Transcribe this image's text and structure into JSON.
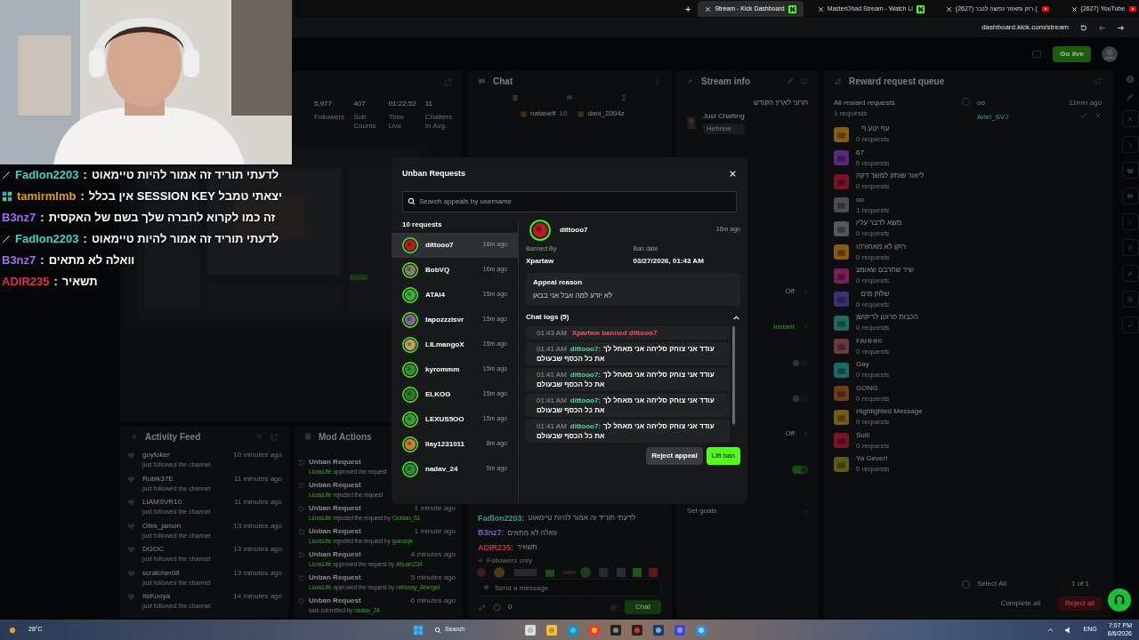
{
  "browser": {
    "new_tab": "+",
    "tabs": [
      {
        "title": "Stream - Kick Dashboard",
        "selected": true,
        "kind": "kick"
      },
      {
        "title": "MasterOhad Stream - Watch Li",
        "selected": false,
        "kind": "kick"
      },
      {
        "title": "(2627) רוק ומאוזר נפשה לנבר (",
        "selected": false,
        "kind": "youtube"
      },
      {
        "title": "(2627) YouTube",
        "selected": false,
        "kind": "youtube"
      }
    ],
    "url": "dashboard.kick.com/stream"
  },
  "header": {
    "go_live": "Go live"
  },
  "stats": [
    {
      "value": "5,977",
      "label": "Followers"
    },
    {
      "value": "407",
      "label": "Sub Counts"
    },
    {
      "value": "01:22:52",
      "label": "Time Live"
    },
    {
      "value": "11",
      "label": "Chatters In Avg."
    }
  ],
  "chat_panel": {
    "title": "Chat",
    "chatters": [
      {
        "name": "natanelf",
        "count": "10"
      },
      {
        "name": "dani_2004z"
      }
    ],
    "messages": [
      {
        "name": "Fadlon2203:",
        "text": "לדעתי תוריד זה אמור להיות טיימאוט",
        "color": "#2f9e85"
      },
      {
        "name": "B3nz7:",
        "text": "וואלה לא מתאים",
        "color": "#8060c0"
      },
      {
        "name": "ADIR235:",
        "text": "תשאיר",
        "color": "#c03050"
      }
    ],
    "mode": "Followers only",
    "placeholder": "Send a message",
    "send": "Chat",
    "count": "0"
  },
  "stream_info": {
    "title": "Stream info",
    "stream_title": "חרוני לארץ הקודש",
    "category": "Just Chatting",
    "language": "Hebrew",
    "settings": [
      {
        "kind": "value",
        "value": "Off"
      },
      {
        "kind": "value",
        "value": "Instant"
      },
      {
        "kind": "toggle",
        "on": false
      },
      {
        "kind": "toggle",
        "on": false
      },
      {
        "kind": "value",
        "value": "Off"
      },
      {
        "kind": "toggle",
        "on": true
      }
    ],
    "goals": "Set goals"
  },
  "reward_queue": {
    "title": "Reward request queue",
    "all": "All reward requests",
    "all_count": "1 requests",
    "pending": {
      "reward": "oo",
      "user": "Ariel_SVJ",
      "time": "11min ago",
      "checked": false
    },
    "rewards": [
      {
        "name": "עף יטע ף",
        "count": "0 requests",
        "color": "#8a5a12"
      },
      {
        "name": "67",
        "count": "0 requests",
        "color": "#5a2a7a"
      },
      {
        "name": "ליאור שותק למשך דקה",
        "count": "0 requests",
        "color": "#7a1424"
      },
      {
        "name": "oo",
        "count": "1 requests",
        "color": "#4a4e52"
      },
      {
        "name": "משא לדבר עליו",
        "count": "0 requests",
        "color": "#55595d"
      },
      {
        "name": "רוקן לא מאחורה!",
        "count": "0 requests",
        "color": "#8a5a12"
      },
      {
        "name": "שיר שחרבם שאומצ",
        "count": "0 requests",
        "color": "#7a1e55"
      },
      {
        "name": "שלוק מים",
        "count": "0 requests",
        "color": "#3a3270"
      },
      {
        "name": "הכבות פרוטן לריקושן",
        "count": "0 requests",
        "color": "#1e6a5e"
      },
      {
        "name": "FAHHH!",
        "count": "0 requests",
        "color": "#6a3a44"
      },
      {
        "name": "Gay",
        "count": "0 requests",
        "color": "#1a6a6a"
      },
      {
        "name": "GONG",
        "count": "0 requests",
        "color": "#6a3e1a"
      },
      {
        "name": "Highlighted Message",
        "count": "0 requests",
        "color": "#7a5a12"
      },
      {
        "name": "Sulil",
        "count": "0 requests",
        "color": "#7a1424"
      },
      {
        "name": "Ya Gever!",
        "count": "0 requests",
        "color": "#5a5a12"
      }
    ],
    "select_all": {
      "label": "Select All",
      "checked": false
    },
    "pages": "1 of 1",
    "complete_all": "Complete all",
    "reject_all": "Reject all"
  },
  "activity_feed": {
    "title": "Activity Feed",
    "items": [
      {
        "name": "guytoker",
        "text": "just followed the channel",
        "time": "10 minutes ago"
      },
      {
        "name": "Rubik37E",
        "text": "just followed the channel",
        "time": "11 minutes ago"
      },
      {
        "name": "LIAMSVR10",
        "text": "just followed the channel",
        "time": "11 minutes ago"
      },
      {
        "name": "Ofek_jamon",
        "text": "just followed the channel",
        "time": "13 minutes ago"
      },
      {
        "name": "DGOC",
        "text": "just followed the channel",
        "time": "13 minutes ago"
      },
      {
        "name": "scratcher08",
        "text": "just followed the channel",
        "time": "13 minutes ago"
      },
      {
        "name": "ItsKooya",
        "text": "just followed the channel",
        "time": "14 minutes ago"
      }
    ]
  },
  "mod_actions": {
    "title": "Mod Actions",
    "items": [
      {
        "title": "Unban Request",
        "moderator": "LionsLife",
        "text": "approved the request"
      },
      {
        "title": "Unban Request",
        "moderator": "LionsLife",
        "text": "rejected the request"
      },
      {
        "title": "Unban Request",
        "moderator": "LionsLife",
        "text": "rejected the request by",
        "user": "Goldan_61",
        "time": "1 minute ago"
      },
      {
        "title": "Unban Request",
        "moderator": "LionsLife",
        "text": "rejected the request by",
        "user": "guessyk",
        "time": "1 minute ago"
      },
      {
        "title": "Unban Request",
        "moderator": "LionsLife",
        "text": "approved the request by",
        "user": "Abuan234",
        "time": "4 minutes ago"
      },
      {
        "title": "Unban Request",
        "moderator": "LionsLife",
        "text": "approved the request by",
        "user": "nehoray_Abergel",
        "time": "5 minutes ago"
      },
      {
        "title": "Unban Request",
        "text": "was submitted by",
        "user": "nadav_24",
        "time": "6 minutes ago"
      }
    ]
  },
  "modal": {
    "title": "Unban Requests",
    "search_placeholder": "Search appeals by username",
    "count": "10 requests",
    "requests": [
      {
        "name": "dittooo7",
        "time": "16m ago",
        "selected": true
      },
      {
        "name": "BobVQ",
        "time": "16m ago",
        "selected": false
      },
      {
        "name": "ATAI4",
        "time": "15m ago",
        "selected": false
      },
      {
        "name": "tapozzzisvr",
        "time": "15m ago",
        "selected": false
      },
      {
        "name": "LILmangoX",
        "time": "15m ago",
        "selected": false
      },
      {
        "name": "kyrommm",
        "time": "15m ago",
        "selected": false
      },
      {
        "name": "ELKOG",
        "time": "15m ago",
        "selected": false
      },
      {
        "name": "LEXUS5OO",
        "time": "15m ago",
        "selected": false
      },
      {
        "name": "Ilay1231011",
        "time": "8m ago",
        "selected": false
      },
      {
        "name": "nadav_24",
        "time": "5m ago",
        "selected": false
      }
    ],
    "detail": {
      "name": "dittooo7",
      "time": "16m ago",
      "banned_by_label": "Banned By",
      "banned_by": "Xpartaw",
      "date_label": "Ban date",
      "date": "03/27/2026, 01:43 AM",
      "reason_label": "Appeal reason",
      "reason": "לא יודע למה אבל אני בבאן",
      "logs_title": "Chat logs (5)",
      "logs_expanded": true,
      "logs": [
        {
          "kind": "ban",
          "time": "01:43 AM",
          "text": "Xpartaw banned dittooo7"
        },
        {
          "kind": "message",
          "time": "01:41 AM",
          "name": "dittooo7:",
          "text": "עודד אני צוחק סליחה אני מאחל לך את כל הכסף שבעולם"
        },
        {
          "kind": "message",
          "time": "01:41 AM",
          "name": "dittooo7:",
          "text": "עודד אני צוחק סליחה אני מאחל לך את כל הכסף שבעולם"
        },
        {
          "kind": "message",
          "time": "01:41 AM",
          "name": "dittooo7:",
          "text": "עודד אני צוחק סליחה אני מאחל לך את כל הכסף שבעולם"
        },
        {
          "kind": "message",
          "time": "01:41 AM",
          "name": "dittooo7:",
          "text": "עודד אני צוחק סליחה אני מאחל לך את כל הכסף שבעולם"
        }
      ]
    },
    "reject": "Reject appeal",
    "lift": "Lift ban"
  },
  "chat_overlay": {
    "separator": ":",
    "lines": [
      {
        "kind": "pencil",
        "name": "Fadlon2203",
        "message": "לדעתי תוריד זה אמור להיות טיימאוט",
        "color": "#3fd5c4"
      },
      {
        "kind": "grid",
        "name": "tamirmlmb",
        "message": "יצאתי טמבל SESSION KEY אין בכלל",
        "color": "#e0a020"
      },
      {
        "kind": "plain",
        "name": "B3nz7",
        "message": "זה כמו לקרוא לחברה שלך בשם של האקסית",
        "color": "#a070f0"
      },
      {
        "kind": "pencil",
        "name": "Fadlon2203",
        "message": "לדעתי תוריד זה אמור להיות טיימאוט",
        "color": "#3fd5c4"
      },
      {
        "kind": "plain",
        "name": "B3nz7",
        "message": "וואלה לא מתאים",
        "color": "#a070f0"
      },
      {
        "kind": "plain",
        "name": "ADIR235",
        "message": "תשאיר",
        "color": "#e0305a"
      }
    ]
  },
  "taskbar": {
    "weather": "28°C",
    "search": "Search",
    "lang": "ENG",
    "time": "7:07 PM",
    "date": "8/6/2026"
  }
}
